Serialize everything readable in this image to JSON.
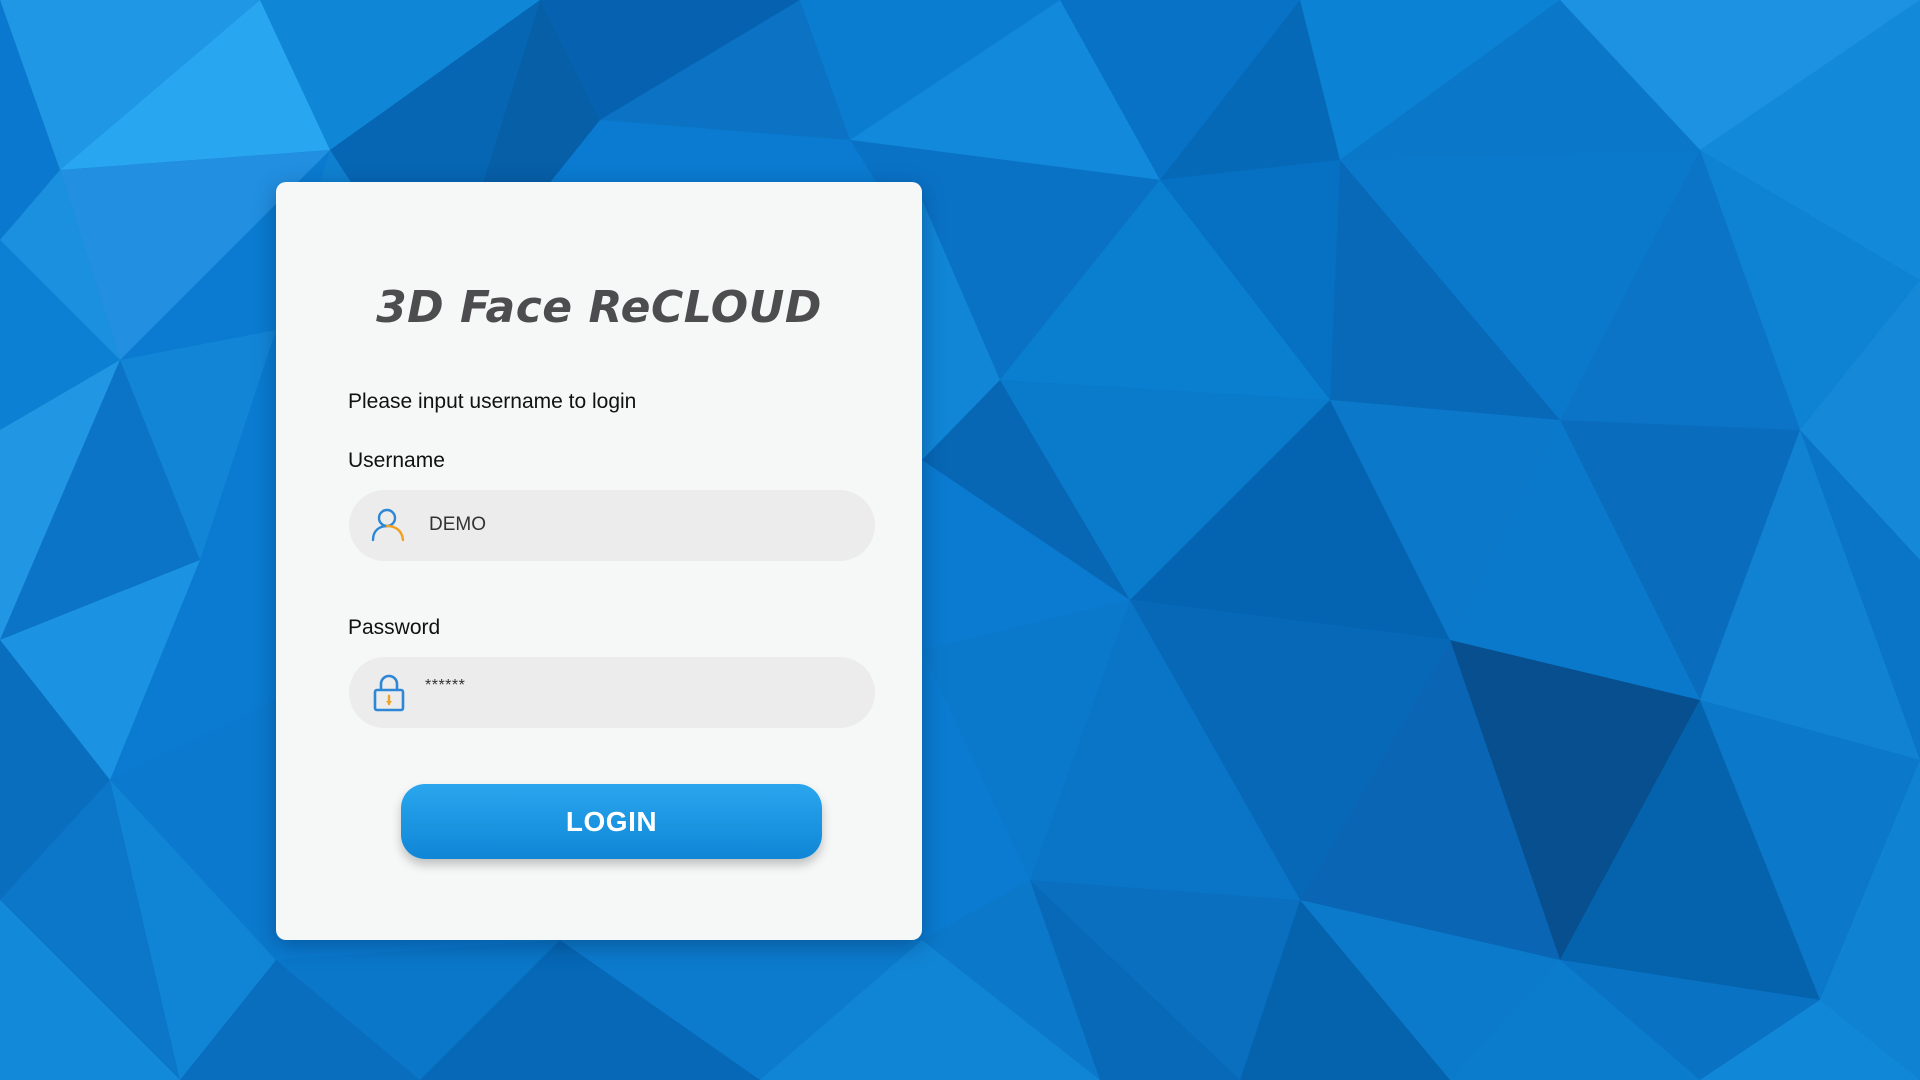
{
  "brand": {
    "title": "3D Face ReCLOUD"
  },
  "login": {
    "hint": "Please input username to login",
    "username": {
      "label": "Username",
      "value": "DEMO",
      "icon": "user-icon"
    },
    "password": {
      "label": "Password",
      "value": "******",
      "icon": "lock-icon"
    },
    "button_label": "LOGIN"
  },
  "colors": {
    "background": "#0a7bd0",
    "card": "#f6f7f7",
    "accent": "#1a93e0",
    "icon_blue": "#2d86d6",
    "icon_orange": "#f0a122"
  }
}
